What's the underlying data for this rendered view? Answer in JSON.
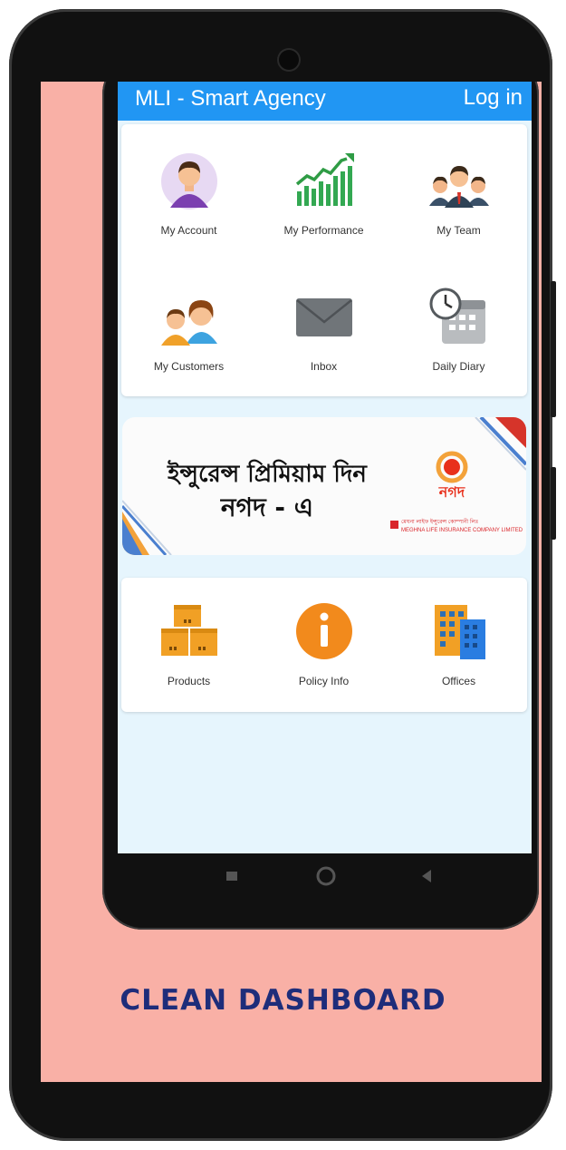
{
  "app": {
    "title": "MLI - Smart Agency",
    "login_label": "Log in"
  },
  "menu_top": [
    {
      "label": "My Account",
      "icon": "account-icon"
    },
    {
      "label": "My Performance",
      "icon": "performance-chart-icon"
    },
    {
      "label": "My Team",
      "icon": "team-icon"
    },
    {
      "label": "My Customers",
      "icon": "customers-icon"
    },
    {
      "label": "Inbox",
      "icon": "envelope-icon"
    },
    {
      "label": "Daily Diary",
      "icon": "calendar-clock-icon"
    }
  ],
  "banner": {
    "line1": "ইন্সুরেন্স প্রিমিয়াম দিন",
    "line2": "নগদ - এ",
    "brand": "নগদ",
    "company_bn": "মেঘনা লাইফ ইন্সুরেন্স কোম্পানী লিঃ",
    "company_en": "MEGHNA LIFE INSURANCE COMPANY LIMITED"
  },
  "menu_bottom": [
    {
      "label": "Products",
      "icon": "boxes-icon"
    },
    {
      "label": "Policy Info",
      "icon": "info-icon"
    },
    {
      "label": "Offices",
      "icon": "buildings-icon"
    }
  ],
  "caption": "CLEAN DASHBOARD",
  "colors": {
    "appbar": "#2196f3",
    "background": "#f9b0a6",
    "caption": "#1e2d7a",
    "screen": "#e6f5fd"
  }
}
